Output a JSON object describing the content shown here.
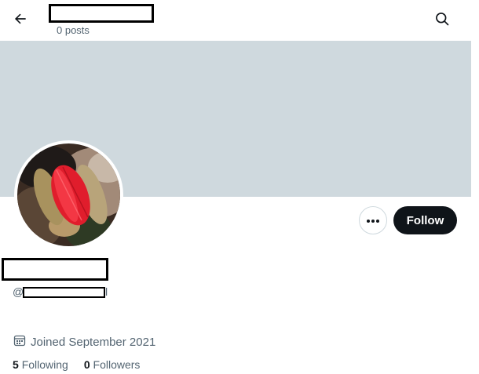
{
  "header": {
    "posts_count": "0 posts"
  },
  "profile": {
    "handle_prefix": "@",
    "handle_tail": "l",
    "joined": "Joined September 2021",
    "following_count": "5",
    "following_label": "Following",
    "followers_count": "0",
    "followers_label": "Followers"
  },
  "actions": {
    "follow_label": "Follow"
  },
  "icons": {
    "back": "arrow-left-icon",
    "search": "search-icon",
    "more": "more-dots-icon",
    "calendar": "calendar-icon"
  },
  "colors": {
    "banner": "#cfd9de",
    "follow_button": "#0f1419",
    "secondary_text": "#536471",
    "primary_text": "#0f1419"
  }
}
